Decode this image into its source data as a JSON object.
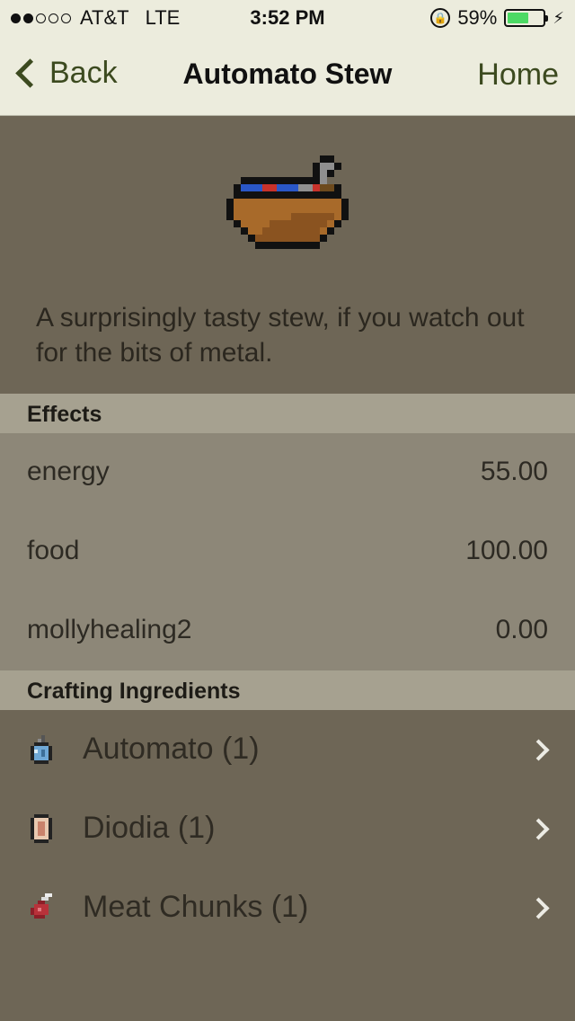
{
  "status_bar": {
    "carrier": "AT&T",
    "network": "LTE",
    "time": "3:52 PM",
    "battery_percent": "59%",
    "battery_level": 0.59,
    "signal_bars_filled": 2,
    "signal_bars_total": 5
  },
  "nav": {
    "back_label": "Back",
    "title": "Automato Stew",
    "home_label": "Home"
  },
  "item": {
    "icon": "stew-bowl-icon",
    "description": "A surprisingly tasty stew, if you watch out for the bits of metal."
  },
  "effects": {
    "header": "Effects",
    "rows": [
      {
        "name": "energy",
        "value": "55.00"
      },
      {
        "name": "food",
        "value": "100.00"
      },
      {
        "name": "mollyhealing2",
        "value": "0.00"
      }
    ]
  },
  "ingredients": {
    "header": "Crafting Ingredients",
    "rows": [
      {
        "label": "Automato (1)",
        "icon": "automato-icon"
      },
      {
        "label": "Diodia (1)",
        "icon": "diodia-icon"
      },
      {
        "label": "Meat Chunks (1)",
        "icon": "meat-chunks-icon"
      }
    ]
  },
  "colors": {
    "nav_tint": "#3c4a1f",
    "background": "#6e6656",
    "section_header": "#a6a190",
    "effects_background": "#8d8778"
  }
}
